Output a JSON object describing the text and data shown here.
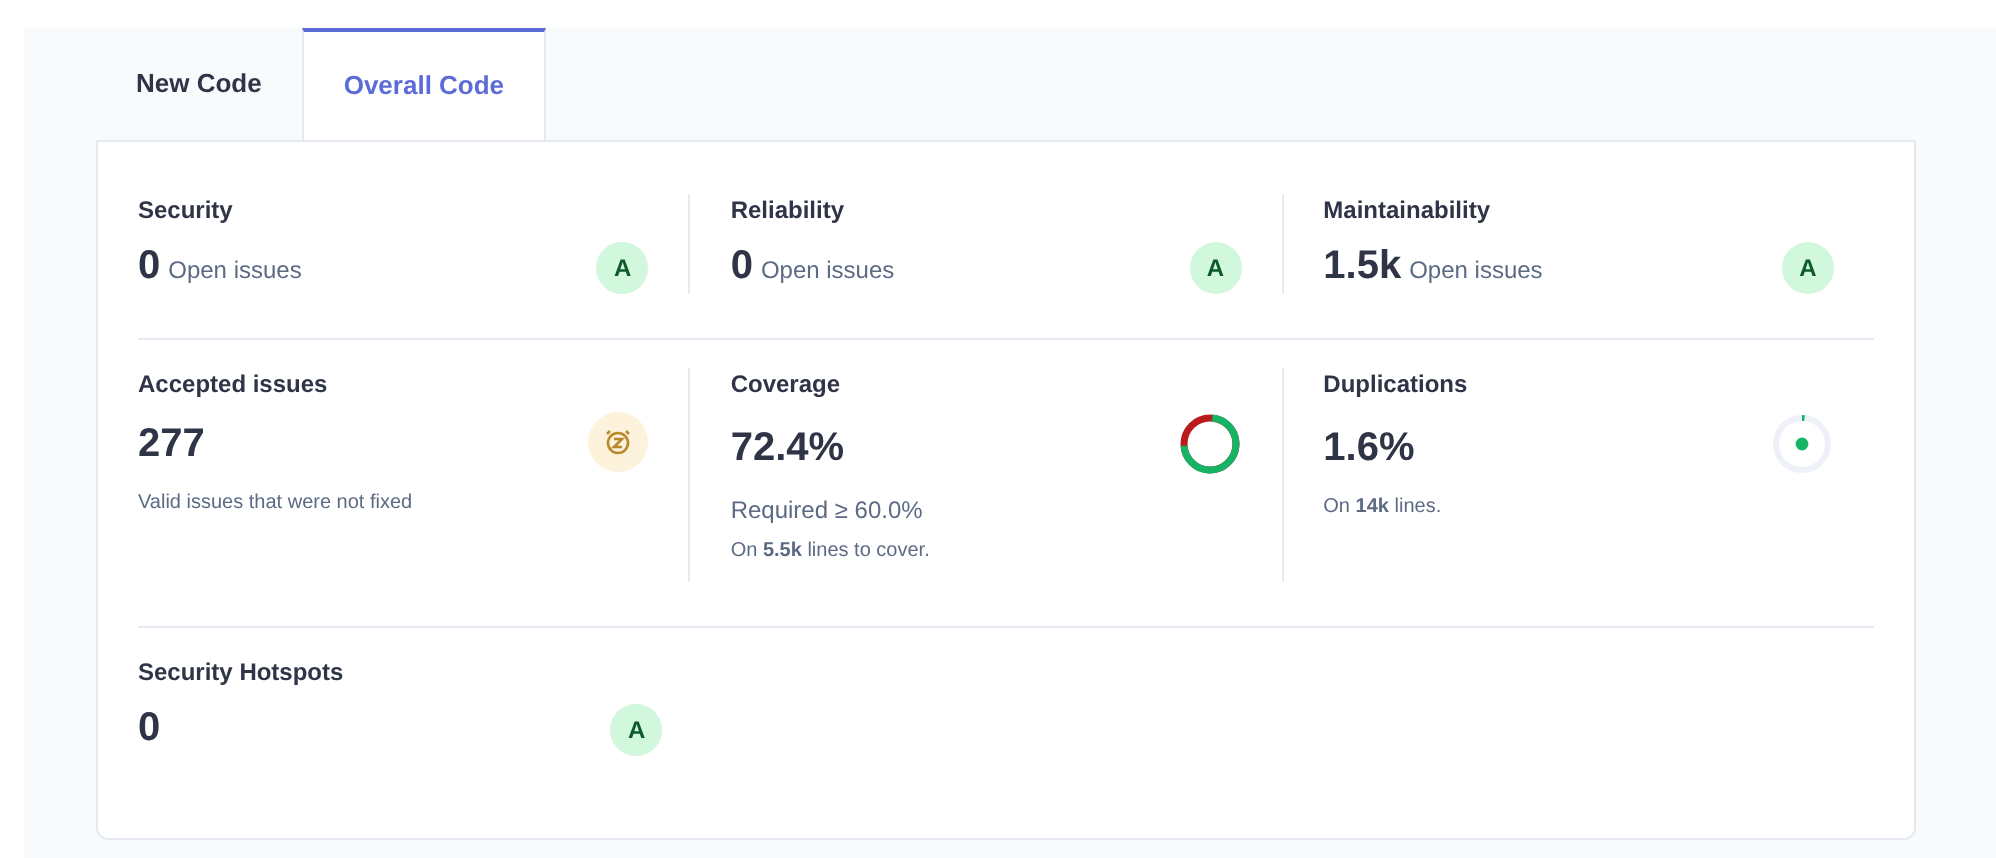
{
  "tabs": [
    {
      "label": "New Code",
      "selected": false
    },
    {
      "label": "Overall Code",
      "selected": true
    }
  ],
  "rows": [
    [
      {
        "kind": "rating",
        "title": "Security",
        "value": "0",
        "unit": "Open issues",
        "rating": "A"
      },
      {
        "kind": "rating",
        "title": "Reliability",
        "value": "0",
        "unit": "Open issues",
        "rating": "A"
      },
      {
        "kind": "rating",
        "title": "Maintainability",
        "value": "1.5k",
        "unit": "Open issues",
        "rating": "A"
      }
    ],
    [
      {
        "kind": "accepted",
        "title": "Accepted issues",
        "value": "277",
        "notes": [
          "Valid issues that were not fixed"
        ]
      },
      {
        "kind": "coverage",
        "title": "Coverage",
        "value": "72.4%",
        "notes": [
          "Required ≥ 60.0%",
          "On **5.5k** lines to cover."
        ]
      },
      {
        "kind": "duplications",
        "title": "Duplications",
        "value": "1.6%",
        "notes": [
          "On **14k** lines."
        ]
      }
    ],
    [
      {
        "kind": "rating",
        "title": "Security Hotspots",
        "value": "0",
        "rating": "A"
      }
    ]
  ]
}
